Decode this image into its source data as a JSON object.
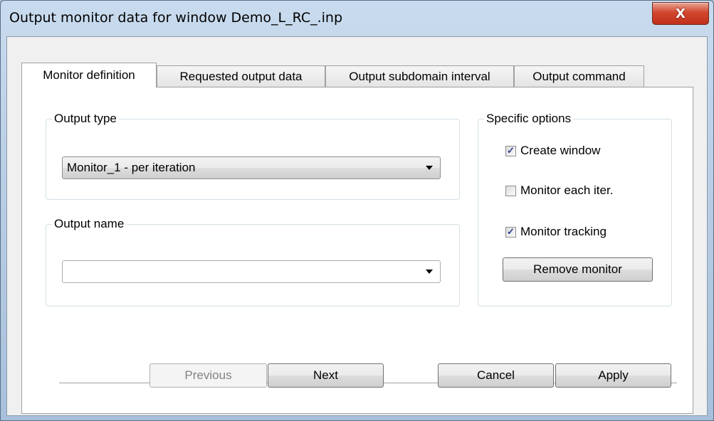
{
  "window": {
    "title": "Output monitor data for window Demo_L_RC_.inp",
    "close_glyph": "X"
  },
  "tabs": [
    {
      "label": "Monitor definition",
      "active": true
    },
    {
      "label": "Requested output data",
      "active": false
    },
    {
      "label": "Output subdomain interval",
      "active": false
    },
    {
      "label": "Output command",
      "active": false
    }
  ],
  "output_type": {
    "group_label": "Output type",
    "selected": "Monitor_1 - per iteration"
  },
  "output_name": {
    "group_label": "Output name",
    "selected": ""
  },
  "specific_options": {
    "group_label": "Specific options",
    "create_window": {
      "label": "Create window",
      "checked": true
    },
    "monitor_each_iter": {
      "label": "Monitor each iter.",
      "checked": false
    },
    "monitor_tracking": {
      "label": "Monitor tracking",
      "checked": true
    },
    "remove_monitor_label": "Remove monitor"
  },
  "buttons": {
    "previous": "Previous",
    "next": "Next",
    "cancel": "Cancel",
    "apply": "Apply"
  },
  "check_glyph": "✓"
}
